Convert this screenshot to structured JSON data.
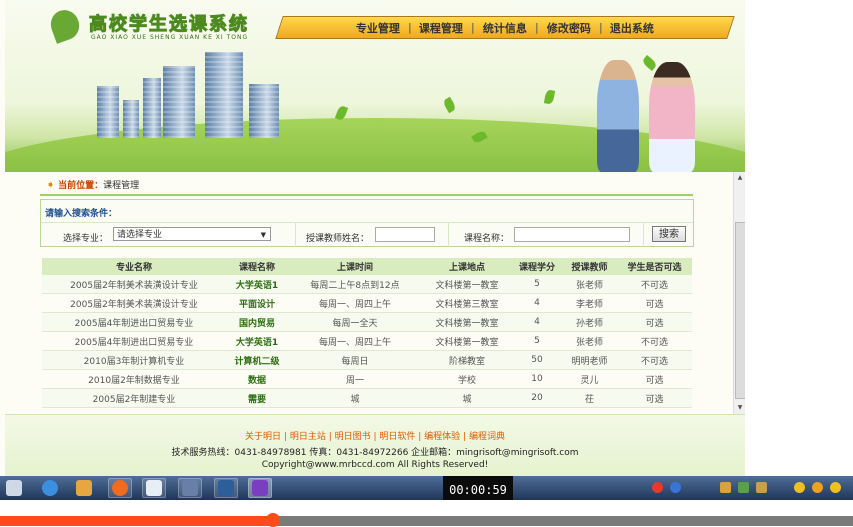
{
  "app": {
    "title": "高校学生选课系统",
    "subtitle": "GAO XIAO XUE SHENG XUAN KE XI TONG"
  },
  "nav": {
    "items": [
      "专业管理",
      "课程管理",
      "统计信息",
      "修改密码",
      "退出系统"
    ],
    "separator": "|"
  },
  "breadcrumb": {
    "label": "当前位置：",
    "value": "课程管理"
  },
  "search": {
    "title": "请输入搜索条件：",
    "major_label": "选择专业：",
    "major_value": "请选择专业",
    "teacher_label": "授课教师姓名：",
    "course_label": "课程名称：",
    "button": "搜索"
  },
  "table": {
    "headers": [
      "专业名称",
      "课程名称",
      "上课时间",
      "上课地点",
      "课程学分",
      "授课教师",
      "学生是否可选"
    ],
    "rows": [
      [
        "2005届2年制美术装潢设计专业",
        "大学英语1",
        "每周二上午8点到12点",
        "文科楼第一教室",
        "5",
        "张老师",
        "不可选"
      ],
      [
        "2005届2年制美术装潢设计专业",
        "平面设计",
        "每周一、周四上午",
        "文科楼第三教室",
        "4",
        "李老师",
        "可选"
      ],
      [
        "2005届4年制进出口贸易专业",
        "国内贸易",
        "每周一全天",
        "文科楼第一教室",
        "4",
        "孙老师",
        "可选"
      ],
      [
        "2005届4年制进出口贸易专业",
        "大学英语1",
        "每周一、周四上午",
        "文科楼第一教室",
        "5",
        "张老师",
        "不可选"
      ],
      [
        "2010届3年制计算机专业",
        "计算机二级",
        "每周日",
        "阶梯教室",
        "50",
        "明明老师",
        "不可选"
      ],
      [
        "2010届2年制数据专业",
        "数据",
        "周一",
        "学校",
        "10",
        "灵儿",
        "可选"
      ],
      [
        "2005届2年制建专业",
        "需要",
        "城",
        "城",
        "20",
        "茌",
        "可选"
      ]
    ]
  },
  "footer": {
    "links": [
      "关于明日",
      "明日主站",
      "明日图书",
      "明日软件",
      "编程体验",
      "编程词典"
    ],
    "link_sep": "|",
    "contact": "技术服务热线：0431-84978981 传真：0431-84972266 企业邮箱：mingrisoft@mingrisoft.com",
    "copyright": "Copyright@www.mrbccd.com All Rights Reserved!"
  },
  "taskbar": {
    "clock": "00:00:59"
  },
  "video": {
    "progress": 0.32
  },
  "colors": {
    "accent_green": "#6aaa2a",
    "nav_gold": "#f0a820",
    "link_orange": "#e05a00",
    "progress_red": "#ff4a1a"
  }
}
